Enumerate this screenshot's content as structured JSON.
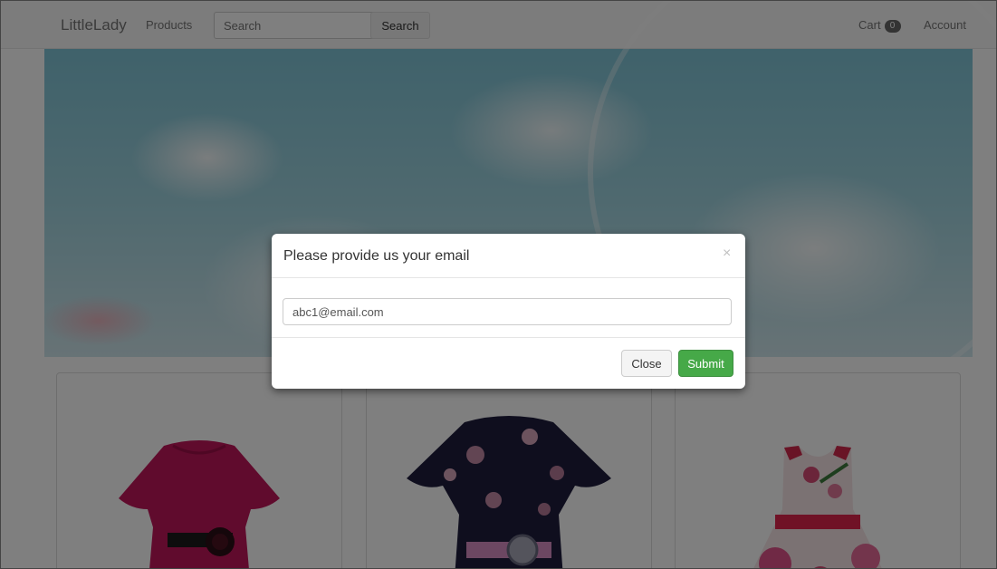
{
  "navbar": {
    "brand": "LittleLady",
    "products_link": "Products",
    "search_placeholder": "Search",
    "search_button": "Search",
    "cart_label": "Cart",
    "cart_count": "0",
    "account_link": "Account"
  },
  "products": [
    {
      "name": "magenta-ruffle-dress",
      "color": "#c0175a"
    },
    {
      "name": "navy-floral-dress",
      "color": "#1e1d3d"
    },
    {
      "name": "white-rose-print-dress",
      "color": "#f6e4e6"
    }
  ],
  "modal": {
    "title": "Please provide us your email",
    "close_x": "×",
    "email_value": "abc1@email.com",
    "close_button": "Close",
    "submit_button": "Submit"
  },
  "colors": {
    "submit_green": "#46a948",
    "navbar_bg": "#f8f8f8",
    "overlay": "rgba(0,0,0,0.5)"
  }
}
